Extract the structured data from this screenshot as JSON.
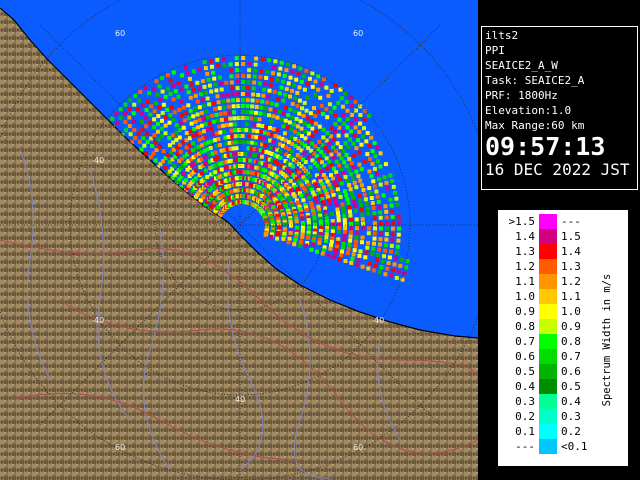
{
  "info": {
    "site": "ilts2",
    "product": "PPI",
    "scan": "SEAICE2_A_W",
    "task": "Task: SEAICE2_A",
    "prf": "PRF: 1800Hz",
    "elevation": "Elevation:1.0",
    "max_range": "Max Range:60 km",
    "time": "09:57:13",
    "date": "16 DEC 2022 JST"
  },
  "map": {
    "range_labels": [
      "60",
      "60",
      "40",
      "40",
      "40",
      "40",
      "60",
      "60"
    ],
    "colors": {
      "sea": "#0a5cff",
      "land": "#8f7a57",
      "coast": "#000000"
    }
  },
  "legend": {
    "unit": "Spectrum Width in m/s",
    "rows": [
      {
        "lo": ">1.5",
        "hi": "---",
        "color": "#ff00ff"
      },
      {
        "lo": "1.4",
        "hi": "1.5",
        "color": "#d20082"
      },
      {
        "lo": "1.3",
        "hi": "1.4",
        "color": "#ff0000"
      },
      {
        "lo": "1.2",
        "hi": "1.3",
        "color": "#ff5a00"
      },
      {
        "lo": "1.1",
        "hi": "1.2",
        "color": "#ff9600"
      },
      {
        "lo": "1.0",
        "hi": "1.1",
        "color": "#ffc800"
      },
      {
        "lo": "0.9",
        "hi": "1.0",
        "color": "#ffff00"
      },
      {
        "lo": "0.8",
        "hi": "0.9",
        "color": "#c8ff00"
      },
      {
        "lo": "0.7",
        "hi": "0.8",
        "color": "#00ff00"
      },
      {
        "lo": "0.6",
        "hi": "0.7",
        "color": "#00dc00"
      },
      {
        "lo": "0.5",
        "hi": "0.6",
        "color": "#00b400"
      },
      {
        "lo": "0.4",
        "hi": "0.5",
        "color": "#008c00"
      },
      {
        "lo": "0.3",
        "hi": "0.4",
        "color": "#00ff96"
      },
      {
        "lo": "0.2",
        "hi": "0.3",
        "color": "#00ffc8"
      },
      {
        "lo": "0.1",
        "hi": "0.2",
        "color": "#00ffff"
      },
      {
        "lo": "---",
        "hi": "<0.1",
        "color": "#00c8ff"
      }
    ]
  }
}
